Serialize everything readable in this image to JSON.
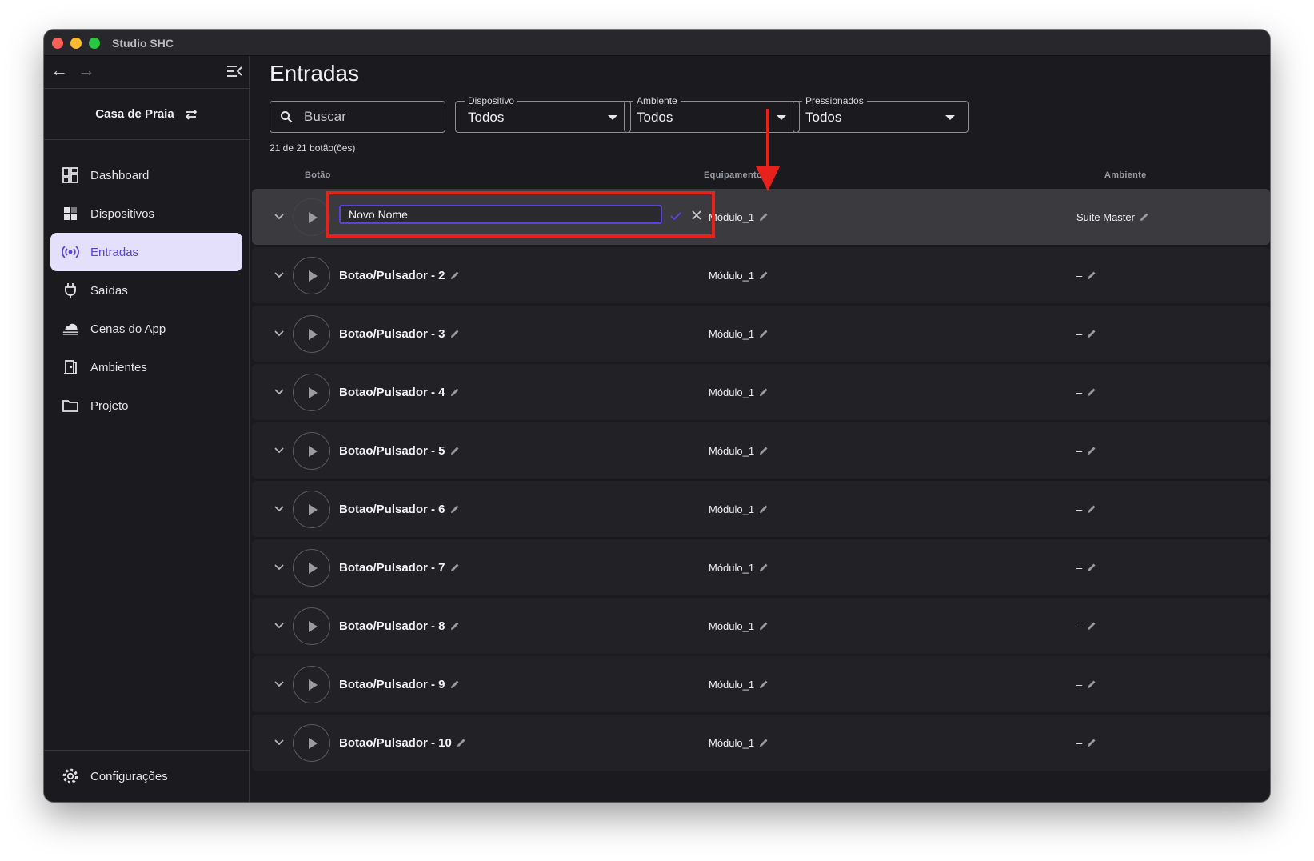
{
  "window": {
    "title": "Studio SHC"
  },
  "sidebar": {
    "project_name": "Casa de Praia",
    "items": [
      {
        "label": "Dashboard",
        "icon": "dashboard-icon",
        "active": false
      },
      {
        "label": "Dispositivos",
        "icon": "devices-icon",
        "active": false
      },
      {
        "label": "Entradas",
        "icon": "broadcast-icon",
        "active": true
      },
      {
        "label": "Saídas",
        "icon": "plug-icon",
        "active": false
      },
      {
        "label": "Cenas do App",
        "icon": "cloud-scene-icon",
        "active": false
      },
      {
        "label": "Ambientes",
        "icon": "door-icon",
        "active": false
      },
      {
        "label": "Projeto",
        "icon": "folder-icon",
        "active": false
      }
    ],
    "settings_label": "Configurações"
  },
  "main": {
    "title": "Entradas",
    "search_placeholder": "Buscar",
    "filters": {
      "dispositivo": {
        "label": "Dispositivo",
        "value": "Todos"
      },
      "ambiente": {
        "label": "Ambiente",
        "value": "Todos"
      },
      "pressionados": {
        "label": "Pressionados",
        "value": "Todos"
      }
    },
    "count_text": "21 de 21 botão(ões)",
    "columns": {
      "botao": "Botão",
      "equipamento": "Equipamento",
      "ambiente": "Ambiente"
    },
    "editing_row": {
      "input_value": "Novo Nome",
      "equipment": "Módulo_1",
      "ambiente": "Suite Master"
    },
    "rows": [
      {
        "name": "Botao/Pulsador - 2",
        "equipment": "Módulo_1",
        "ambiente": "–"
      },
      {
        "name": "Botao/Pulsador - 3",
        "equipment": "Módulo_1",
        "ambiente": "–"
      },
      {
        "name": "Botao/Pulsador - 4",
        "equipment": "Módulo_1",
        "ambiente": "–"
      },
      {
        "name": "Botao/Pulsador - 5",
        "equipment": "Módulo_1",
        "ambiente": "–"
      },
      {
        "name": "Botao/Pulsador - 6",
        "equipment": "Módulo_1",
        "ambiente": "–"
      },
      {
        "name": "Botao/Pulsador - 7",
        "equipment": "Módulo_1",
        "ambiente": "–"
      },
      {
        "name": "Botao/Pulsador - 8",
        "equipment": "Módulo_1",
        "ambiente": "–"
      },
      {
        "name": "Botao/Pulsador - 9",
        "equipment": "Módulo_1",
        "ambiente": "–"
      },
      {
        "name": "Botao/Pulsador - 10",
        "equipment": "Módulo_1",
        "ambiente": "–"
      }
    ]
  },
  "colors": {
    "accent": "#5b43d6",
    "active_bg": "#e4e0fb",
    "annotation_red": "#e8221b",
    "window_bg": "#1b1b1f",
    "row_bg": "#222226"
  }
}
